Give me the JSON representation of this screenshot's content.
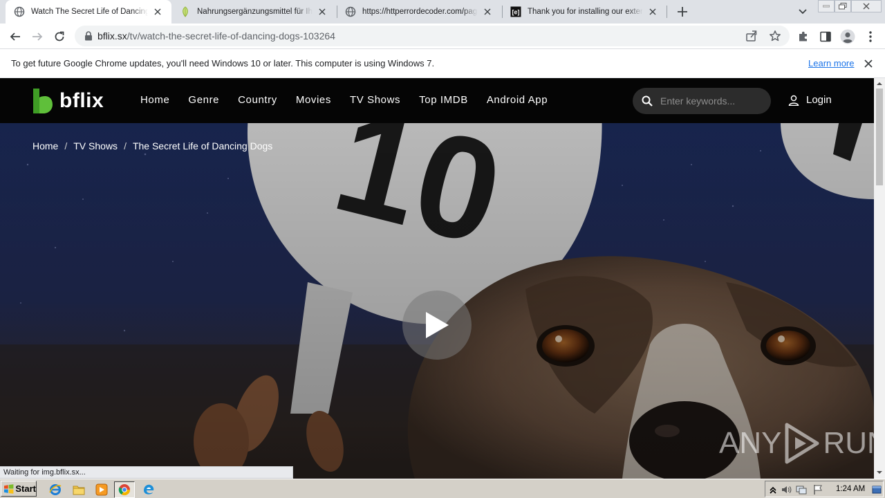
{
  "browser": {
    "tabs": [
      {
        "title": "Watch The Secret Life of Dancing Dogs",
        "favicon": "globe-icon",
        "active": true
      },
      {
        "title": "Nahrungsergänzungsmittel für Ihre Gesundheit",
        "favicon": "leaf-icon",
        "active": false
      },
      {
        "title": "https://httperrordecoder.com/page/",
        "favicon": "globe-icon",
        "active": false
      },
      {
        "title": "Thank you for installing our extension",
        "favicon": "extension-logo-icon",
        "active": false
      }
    ],
    "url_host": "bflix.sx",
    "url_path": "/tv/watch-the-secret-life-of-dancing-dogs-103264",
    "infobar": {
      "message": "To get future Google Chrome updates, you'll need Windows 10 or later. This computer is using Windows 7.",
      "link": "Learn more"
    },
    "status_text": "Waiting for img.bflix.sx..."
  },
  "site": {
    "logo_text": "bflix",
    "nav": [
      "Home",
      "Genre",
      "Country",
      "Movies",
      "TV Shows",
      "Top IMDB",
      "Android App"
    ],
    "search_placeholder": "Enter keywords...",
    "login_label": "Login",
    "breadcrumb": [
      "Home",
      "TV Shows",
      "The Secret Life of Dancing Dogs"
    ],
    "accent_color": "#5fbf3a",
    "hero_sign_number": "10"
  },
  "watermark": {
    "left": "ANY",
    "right": "RUN"
  },
  "taskbar": {
    "start_label": "Start",
    "clock": "1:24 AM"
  }
}
